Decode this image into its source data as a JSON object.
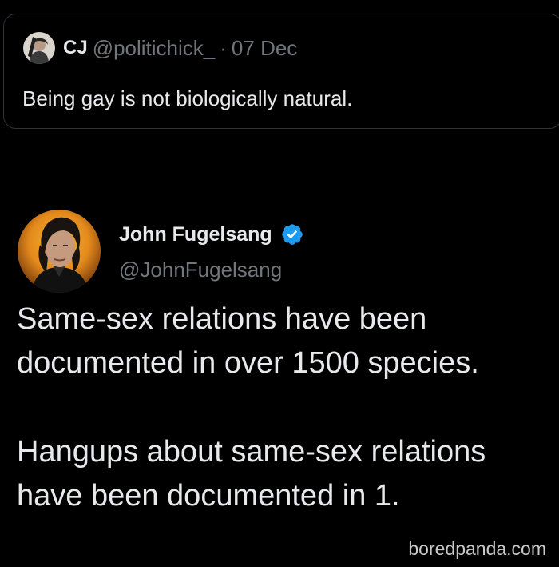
{
  "quoted_tweet": {
    "author_name": "CJ",
    "handle": "@politichick_",
    "separator": "·",
    "date": "07 Dec",
    "text": "Being gay is not biologically natural.",
    "avatar_icon": "user-avatar-photo"
  },
  "main_tweet": {
    "author_name": "John Fugelsang",
    "handle": "@JohnFugelsang",
    "verified": true,
    "verified_icon": "verified-badge-icon",
    "avatar_icon": "user-avatar-photo",
    "paragraphs": [
      [
        "Same-sex relations have been",
        "documented in over 1500 species."
      ],
      [
        "Hangups about same-sex relations",
        "have been documented in 1."
      ]
    ]
  },
  "watermark": "boredpanda.com",
  "colors": {
    "background": "#000000",
    "text_primary": "#e7e9ea",
    "text_secondary": "#71767b",
    "border": "#2f3336",
    "verified_blue": "#1d9bf0"
  }
}
